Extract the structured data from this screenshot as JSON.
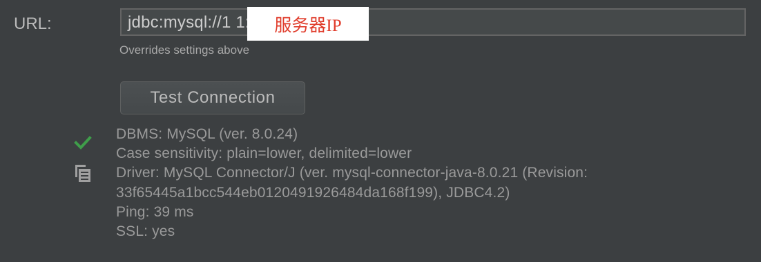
{
  "url_label": "URL:",
  "url_value": "jdbc:mysql://1                           1:3306/lab1",
  "redaction_label": "服务器IP",
  "url_hint": "Overrides settings above",
  "test_connection_label": "Test Connection",
  "status_icon": "check-icon",
  "copy_icon": "copy-icon",
  "success_color": "#3f9e4a",
  "info_lines": [
    "DBMS: MySQL (ver. 8.0.24)",
    "Case sensitivity: plain=lower, delimited=lower",
    "Driver: MySQL Connector/J (ver. mysql-connector-java-8.0.21 (Revision:",
    "33f65445a1bcc544eb0120491926484da168f199), JDBC4.2)",
    "Ping: 39 ms",
    "SSL: yes"
  ]
}
